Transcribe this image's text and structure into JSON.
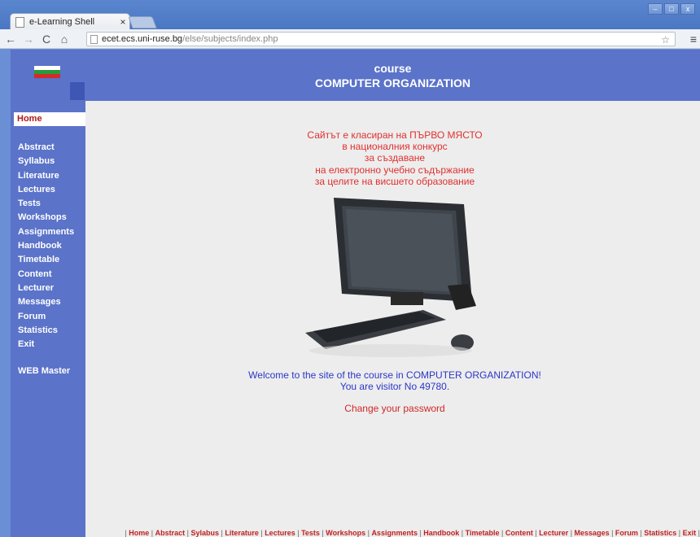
{
  "browser": {
    "tab_title": "e-Learning Shell",
    "tab_close": "×",
    "url_host": "ecet.ecs.uni-ruse.bg",
    "url_path": "/else/subjects/index.php",
    "window_controls": [
      "–",
      "□",
      "x"
    ]
  },
  "header": {
    "course_label": "course",
    "title": "COMPUTER ORGANIZATION"
  },
  "sidebar": {
    "active": "Home",
    "items": [
      "Abstract",
      "Syllabus",
      "Literature",
      "Lectures",
      "Tests",
      "Workshops",
      "Assignments",
      "Handbook",
      "Timetable",
      "Content",
      "Lecturer",
      "Messages",
      "Forum",
      "Statistics",
      "Exit"
    ],
    "webmaster": "WEB Master"
  },
  "main": {
    "announcement": [
      "Сайтът е класиран на ПЪРВО МЯСТО",
      "в националния конкурс",
      "за създаване",
      "на електронно учебно съдържание",
      "за целите на висшето образование"
    ],
    "welcome_line1": "Welcome to the site of the course in  COMPUTER ORGANIZATION!",
    "welcome_line2": "You are visitor No 49780.",
    "change_password": "Change your password"
  },
  "footer": {
    "links": [
      "Home",
      "Abstract",
      "Sylabus",
      "Literature",
      "Lectures",
      "Tests",
      "Workshops",
      "Assignments",
      "Handbook",
      "Timetable",
      "Content",
      "Lecturer",
      "Messages",
      "Forum",
      "Statistics",
      "Exit"
    ]
  },
  "colors": {
    "sidebar_bg": "#5b73c9",
    "accent_red": "#e03030",
    "welcome_blue": "#2a37c8"
  }
}
